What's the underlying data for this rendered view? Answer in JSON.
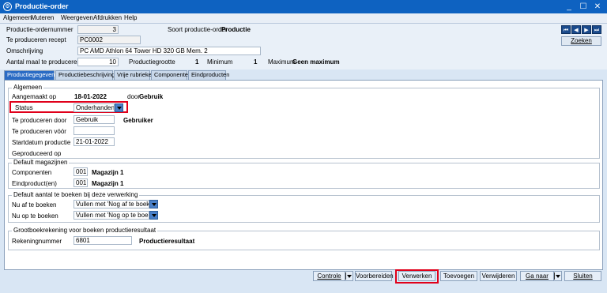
{
  "window": {
    "title": "Productie-order",
    "icon": "app-logo-icon",
    "controls": [
      "_",
      "☐",
      "✕"
    ]
  },
  "menu": [
    "Algemeen",
    "Muteren",
    "Weergeven",
    "Afdrukken",
    "Help"
  ],
  "header": {
    "ordernummer_label": "Productie-ordernummer",
    "ordernummer_value": "3",
    "soort_label": "Soort productie-order",
    "soort_value": "Productie",
    "recept_label": "Te produceren recept",
    "recept_value": "PC0002",
    "omschrijving_label": "Omschrijving",
    "omschrijving_value": "PC AMD Athlon 64 Tower HD 320 GB Mem. 2",
    "aantal_label": "Aantal maal te produceren",
    "aantal_value": "10",
    "grootte_label": "Productiegrootte",
    "grootte_value": "1",
    "minimum_label": "Minimum",
    "minimum_value": "1",
    "maximum_label": "Maximum",
    "maximum_value": "Geen maximum",
    "zoeken_label": "Zoeken"
  },
  "tabs": [
    "Productiegegevens",
    "Productiebeschrijving",
    "Vrije rubrieken",
    "Componenten",
    "Eindproducten"
  ],
  "active_tab": "Productiegegevens",
  "algemeen": {
    "title": "Algemeen",
    "aangemaakt_label": "Aangemaakt op",
    "aangemaakt_value": "18-01-2022",
    "door_label": "door",
    "door_value": "Gebruik",
    "status_label": "Status",
    "status_value": "Onderhanden",
    "door_produceren_label": "Te produceren door",
    "door_produceren_value": "Gebruik",
    "door_produceren_name": "Gebruiker",
    "voor_label": "Te produceren vóór",
    "voor_value": "",
    "startdatum_label": "Startdatum productie",
    "startdatum_value": "21-01-2022",
    "geproduceerd_label": "Geproduceerd op"
  },
  "magazijnen": {
    "title": "Default magazijnen",
    "componenten_label": "Componenten",
    "componenten_code": "001",
    "componenten_name": "Magazijn 1",
    "eindproduct_label": "Eindproduct(en)",
    "eindproduct_code": "001",
    "eindproduct_name": "Magazijn 1"
  },
  "aantal": {
    "title": "Default aantal te boeken bij deze verwerking",
    "af_label": "Nu af te boeken",
    "af_value": "Vullen met 'Nog af te boeken'",
    "op_label": "Nu op te boeken",
    "op_value": "Vullen met 'Nog op te boeken'"
  },
  "grootboek": {
    "title": "Grootboekrekening voor boeken productieresultaat",
    "rek_label": "Rekeningnummer",
    "rek_value": "6801",
    "rek_name": "Productieresultaat"
  },
  "footer": {
    "controle": "Controle",
    "voorbereiden": "Voorbereiden",
    "verwerken": "Verwerken",
    "toevoegen": "Toevoegen",
    "verwijderen": "Verwijderen",
    "ganaar": "Ga naar",
    "sluiten": "Sluiten"
  }
}
